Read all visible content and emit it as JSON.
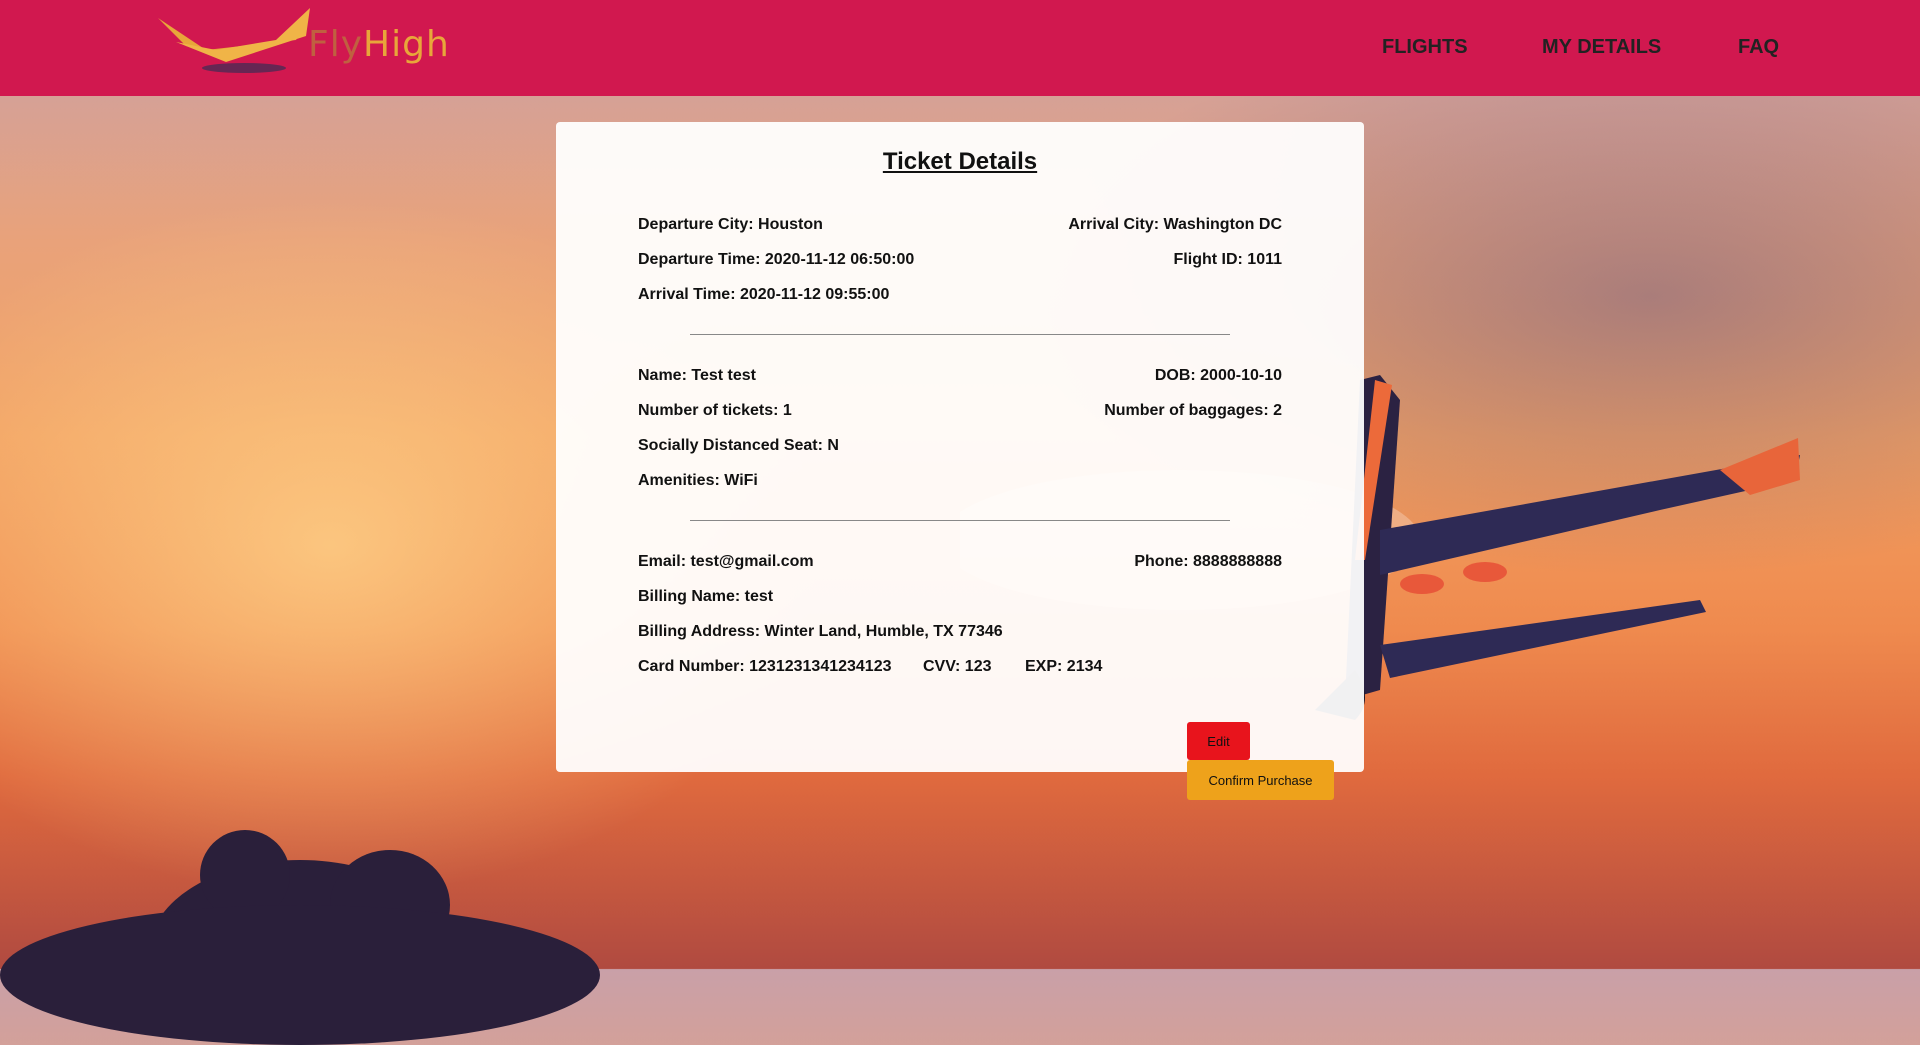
{
  "brand": {
    "name": "FlyHigh",
    "name_part1": "Fly",
    "name_part2": "High",
    "logo_color": "#e8a63a"
  },
  "colors": {
    "header": "#d1184f",
    "edit_button": "#e8141c",
    "confirm_button": "#eea21b"
  },
  "nav": {
    "flights": "FLIGHTS",
    "my_details": "MY DETAILS",
    "faq": "FAQ"
  },
  "ticket": {
    "title": "Ticket Details",
    "departure_city": "Departure City: Houston",
    "arrival_city": "Arrival City: Washington DC",
    "departure_time": "Departure Time: 2020-11-12 06:50:00",
    "flight_id": "Flight ID: 1011",
    "arrival_time": "Arrival Time: 2020-11-12 09:55:00",
    "name": "Name: Test test",
    "dob": "DOB: 2000-10-10",
    "num_tickets": "Number of tickets: 1",
    "num_baggages": "Number of baggages: 2",
    "distanced_seat": "Socially Distanced Seat: N",
    "amenities": "Amenities: WiFi",
    "email": "Email: test@gmail.com",
    "phone": "Phone: 8888888888",
    "billing_name": "Billing Name: test",
    "billing_address": "Billing Address: Winter Land, Humble, TX 77346",
    "card_number": "Card Number: 1231231341234123",
    "cvv": "CVV: 123",
    "exp": "EXP: 2134"
  },
  "buttons": {
    "edit": "Edit",
    "confirm": "Confirm Purchase"
  }
}
